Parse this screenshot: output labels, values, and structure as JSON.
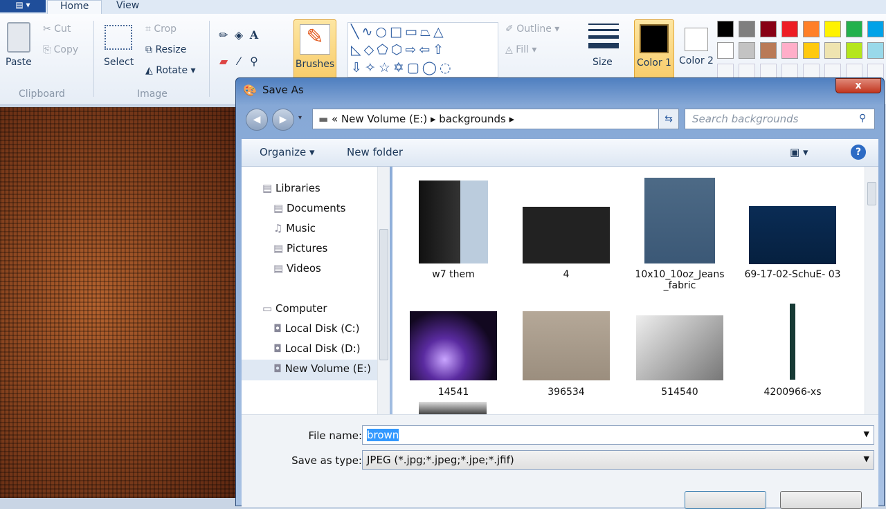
{
  "paint": {
    "tabs": [
      "Home",
      "View"
    ],
    "clipboard": {
      "paste": "Paste",
      "cut": "Cut",
      "copy": "Copy",
      "group": "Clipboard"
    },
    "image": {
      "select": "Select",
      "crop": "Crop",
      "resize": "Resize",
      "rotate": "Rotate",
      "group": "Image"
    },
    "brushes": "Brushes",
    "outline": "Outline",
    "fill": "Fill",
    "size": "Size",
    "color1": "Color 1",
    "color2": "Color 2",
    "palette_row1": [
      "#000000",
      "#7f7f7f",
      "#880015",
      "#ed1c24",
      "#ff7f27",
      "#fff200",
      "#22b14c",
      "#00a2e8"
    ],
    "palette_row2": [
      "#ffffff",
      "#c3c3c3",
      "#b97a57",
      "#ffaec9",
      "#ffc90e",
      "#efe4b0",
      "#b5e61d",
      "#99d9ea"
    ]
  },
  "dialog": {
    "title": "Save As",
    "close": "x",
    "address": {
      "root": "New Volume (E:)",
      "folder": "backgrounds",
      "prefix": "«"
    },
    "search_placeholder": "Search backgrounds",
    "toolbar": {
      "organize": "Organize",
      "new_folder": "New folder"
    },
    "nav": {
      "libraries": "Libraries",
      "lib_items": [
        "Documents",
        "Music",
        "Pictures",
        "Videos"
      ],
      "computer": "Computer",
      "drives": [
        "Local Disk (C:)",
        "Local Disk (D:)",
        "New Volume (E:)"
      ]
    },
    "files": [
      {
        "name": "w7 them",
        "kind": "folder"
      },
      {
        "name": "4",
        "kind": "image"
      },
      {
        "name": "10x10_10oz_Jeans _fabric",
        "kind": "image"
      },
      {
        "name": "69-17-02-SchuE- 03",
        "kind": "image"
      },
      {
        "name": "14541",
        "kind": "image"
      },
      {
        "name": "396534",
        "kind": "image"
      },
      {
        "name": "514540",
        "kind": "image"
      },
      {
        "name": "4200966-xs",
        "kind": "image"
      }
    ],
    "file_name_label": "File name:",
    "file_name_value": "brown",
    "save_type_label": "Save as type:",
    "save_type_value": "JPEG (*.jpg;*.jpeg;*.jpe;*.jfif)"
  }
}
